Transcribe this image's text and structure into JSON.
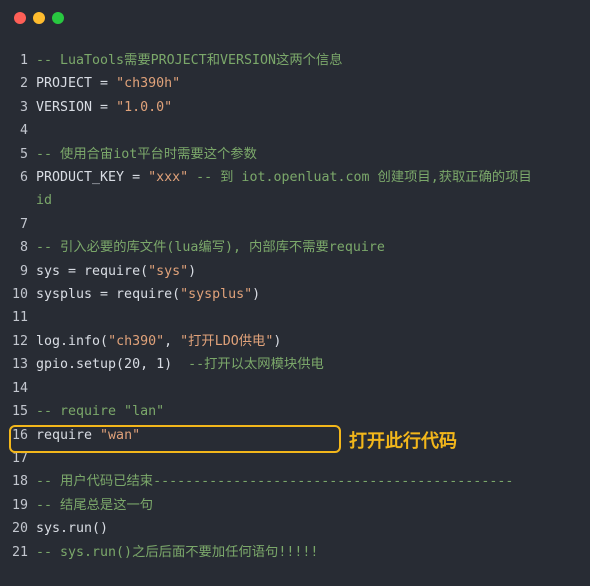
{
  "window": {
    "controls": [
      {
        "name": "close",
        "color": "#fe5f57"
      },
      {
        "name": "minimize",
        "color": "#febc2e"
      },
      {
        "name": "maximize",
        "color": "#28c840"
      }
    ]
  },
  "colors": {
    "background": "#282c34",
    "comment": "#7ba86a",
    "string": "#e0a27a",
    "highlight": "#f3b71b"
  },
  "lines": [
    {
      "n": "1",
      "parts": [
        [
          "com",
          "-- LuaTools需要PROJECT和VERSION这两个信息"
        ]
      ]
    },
    {
      "n": "2",
      "parts": [
        [
          "id",
          "PROJECT = "
        ],
        [
          "str",
          "\"ch390h\""
        ]
      ]
    },
    {
      "n": "3",
      "parts": [
        [
          "id",
          "VERSION = "
        ],
        [
          "str",
          "\"1.0.0\""
        ]
      ]
    },
    {
      "n": "4",
      "parts": []
    },
    {
      "n": "5",
      "parts": [
        [
          "com",
          "-- 使用合宙iot平台时需要这个参数"
        ]
      ]
    },
    {
      "n": "6",
      "parts": [
        [
          "id",
          "PRODUCT_KEY = "
        ],
        [
          "str",
          "\"xxx\""
        ],
        [
          "com",
          " -- 到 iot.openluat.com 创建项目,获取正确的项目"
        ]
      ]
    },
    {
      "n": "",
      "parts": [
        [
          "com",
          "id"
        ]
      ]
    },
    {
      "n": "7",
      "parts": []
    },
    {
      "n": "8",
      "parts": [
        [
          "com",
          "-- 引入必要的库文件(lua编写), 内部库不需要require"
        ]
      ]
    },
    {
      "n": "9",
      "parts": [
        [
          "id",
          "sys = require("
        ],
        [
          "str",
          "\"sys\""
        ],
        [
          "id",
          ")"
        ]
      ]
    },
    {
      "n": "10",
      "parts": [
        [
          "id",
          "sysplus = require("
        ],
        [
          "str",
          "\"sysplus\""
        ],
        [
          "id",
          ")"
        ]
      ]
    },
    {
      "n": "11",
      "parts": []
    },
    {
      "n": "12",
      "parts": [
        [
          "id",
          "log.info("
        ],
        [
          "str",
          "\"ch390\""
        ],
        [
          "id",
          ", "
        ],
        [
          "str",
          "\"打开LDO供电\""
        ],
        [
          "id",
          ")"
        ]
      ]
    },
    {
      "n": "13",
      "parts": [
        [
          "id",
          "gpio.setup(20, 1)  "
        ],
        [
          "com",
          "--打开以太网模块供电"
        ]
      ]
    },
    {
      "n": "14",
      "parts": []
    },
    {
      "n": "15",
      "parts": [
        [
          "com",
          "-- require \"lan\""
        ]
      ]
    },
    {
      "n": "16",
      "parts": [
        [
          "id",
          "require "
        ],
        [
          "str",
          "\"wan\""
        ]
      ]
    },
    {
      "n": "17",
      "parts": []
    },
    {
      "n": "18",
      "parts": [
        [
          "com",
          "-- 用户代码已结束---------------------------------------------"
        ]
      ]
    },
    {
      "n": "19",
      "parts": [
        [
          "com",
          "-- 结尾总是这一句"
        ]
      ]
    },
    {
      "n": "20",
      "parts": [
        [
          "id",
          "sys.run()"
        ]
      ]
    },
    {
      "n": "21",
      "parts": [
        [
          "com",
          "-- sys.run()之后后面不要加任何语句!!!!!"
        ]
      ]
    }
  ],
  "annotation": {
    "text": "打开此行代码"
  }
}
